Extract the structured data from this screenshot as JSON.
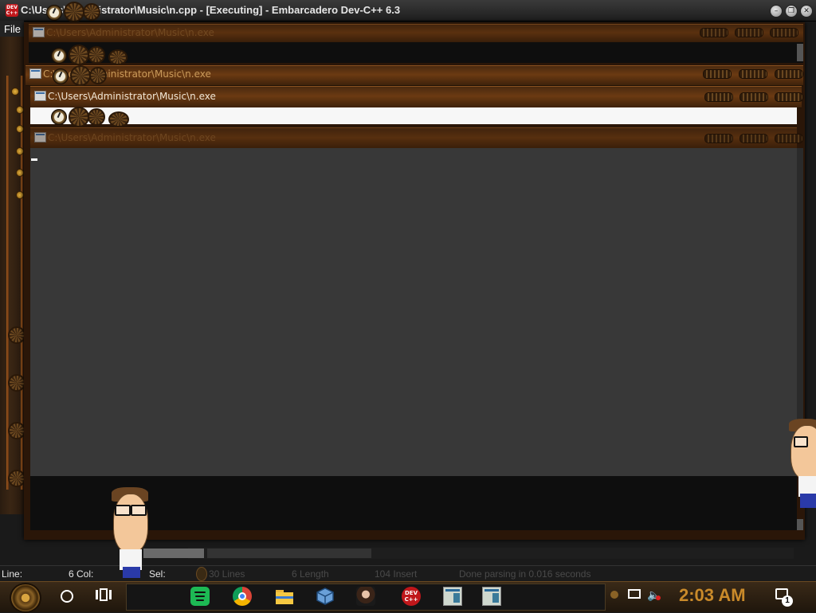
{
  "main_window": {
    "title": "C:\\Users\\Administrator\\Music\\n.cpp - [Executing] - Embarcadero Dev-C++ 6.3",
    "app_icon_text": "DEV C++",
    "menu": {
      "file": "File"
    }
  },
  "console_windows": [
    {
      "title": "C:\\Users\\Administrator\\Music\\n.exe",
      "state": "dim"
    },
    {
      "title": "C:\\Users\\Administrator\\Music\\n.exe",
      "state": "normal"
    },
    {
      "title": "C:\\Users\\Administrator\\Music\\n.exe",
      "state": "active"
    },
    {
      "title": "C:\\Users\\Administrator\\Music\\n.exe",
      "state": "dim"
    }
  ],
  "status_bar": {
    "line_label": "Line:",
    "col_value": "6",
    "col_label": "Col:",
    "sel_label": "Sel:",
    "lines": "30 Lines",
    "length": "6 Length",
    "insert": "104 Insert",
    "message": "Done parsing in 0.016 seconds"
  },
  "taskbar": {
    "icons": [
      "spotify-icon",
      "chrome-icon",
      "file-explorer-icon",
      "virtualbox-icon",
      "user-avatar-icon",
      "devcpp-icon",
      "console-window-icon",
      "console-window-icon"
    ],
    "devcpp_label": "DEV C++",
    "clock": "2:03 AM",
    "notification_count": "1"
  },
  "colors": {
    "steampunk_brown": "#6b3a12",
    "clock_orange": "#c98a2a",
    "console_bg": "#383838",
    "dev_red": "#c0171b"
  }
}
